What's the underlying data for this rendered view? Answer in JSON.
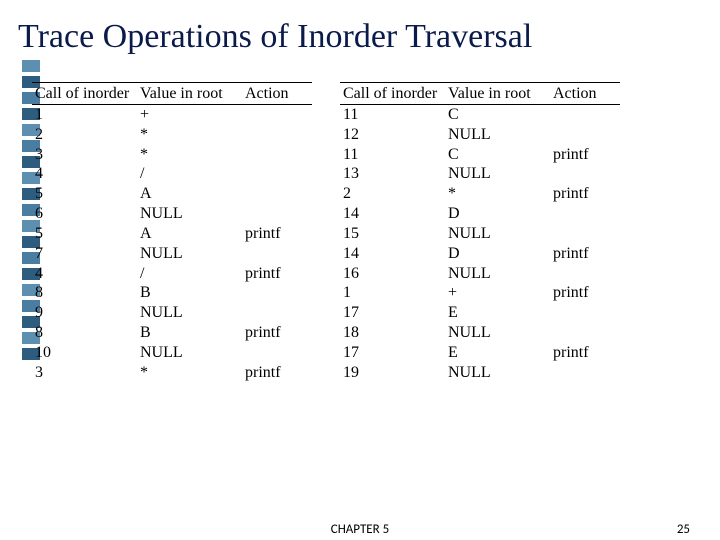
{
  "title": "Trace Operations of Inorder Traversal",
  "headers": {
    "call": "Call of inorder",
    "value": "Value in root",
    "action": "Action"
  },
  "tableLeft": [
    {
      "call": "1",
      "value": "+",
      "action": ""
    },
    {
      "call": "2",
      "value": "*",
      "action": ""
    },
    {
      "call": "3",
      "value": "*",
      "action": ""
    },
    {
      "call": "4",
      "value": "/",
      "action": ""
    },
    {
      "call": "5",
      "value": "A",
      "action": ""
    },
    {
      "call": "6",
      "value": "NULL",
      "action": ""
    },
    {
      "call": "5",
      "value": "A",
      "action": "printf"
    },
    {
      "call": "7",
      "value": "NULL",
      "action": ""
    },
    {
      "call": "4",
      "value": "/",
      "action": "printf"
    },
    {
      "call": "8",
      "value": "B",
      "action": ""
    },
    {
      "call": "9",
      "value": "NULL",
      "action": ""
    },
    {
      "call": "8",
      "value": "B",
      "action": "printf"
    },
    {
      "call": "10",
      "value": "NULL",
      "action": ""
    },
    {
      "call": "3",
      "value": "*",
      "action": "printf"
    }
  ],
  "tableRight": [
    {
      "call": "11",
      "value": "C",
      "action": ""
    },
    {
      "call": "12",
      "value": "NULL",
      "action": ""
    },
    {
      "call": "11",
      "value": "C",
      "action": "printf"
    },
    {
      "call": "13",
      "value": "NULL",
      "action": ""
    },
    {
      "call": "2",
      "value": "*",
      "action": "printf"
    },
    {
      "call": "14",
      "value": "D",
      "action": ""
    },
    {
      "call": "15",
      "value": "NULL",
      "action": ""
    },
    {
      "call": "14",
      "value": "D",
      "action": "printf"
    },
    {
      "call": "16",
      "value": "NULL",
      "action": ""
    },
    {
      "call": "1",
      "value": "+",
      "action": "printf"
    },
    {
      "call": "17",
      "value": "E",
      "action": ""
    },
    {
      "call": "18",
      "value": "NULL",
      "action": ""
    },
    {
      "call": "17",
      "value": "E",
      "action": "printf"
    },
    {
      "call": "19",
      "value": "NULL",
      "action": ""
    }
  ],
  "footer": {
    "chapter": "CHAPTER 5",
    "page": "25"
  }
}
